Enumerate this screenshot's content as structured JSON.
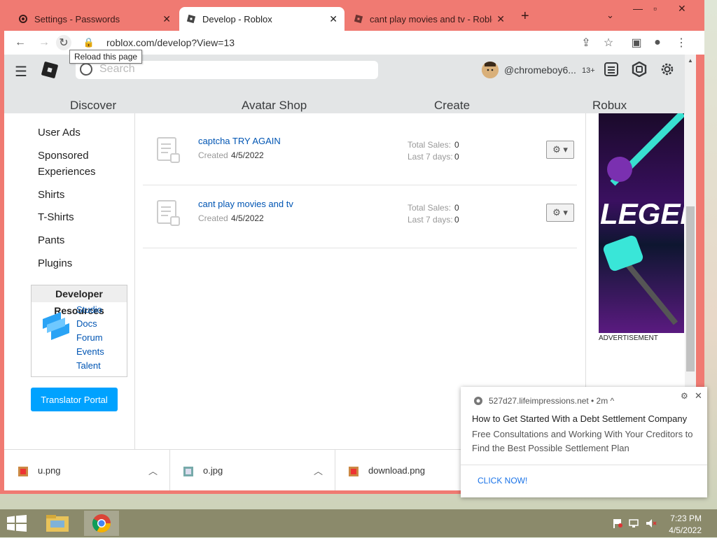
{
  "browser": {
    "tabs": [
      {
        "title": "Settings - Passwords",
        "active": false
      },
      {
        "title": "Develop - Roblox",
        "active": true
      },
      {
        "title": "cant play movies and tv - Roblox",
        "active": false
      }
    ],
    "new_tab": "+",
    "url": "roblox.com/develop?View=13",
    "tooltip": "Reload this page"
  },
  "roblox": {
    "search_placeholder": "Search",
    "nav": [
      "Discover",
      "Avatar Shop",
      "Create",
      "Robux"
    ],
    "username": "@chromeboy6...",
    "age_badge": "13+",
    "left_menu": [
      "User Ads",
      "Sponsored Experiences",
      "Shirts",
      "T-Shirts",
      "Pants",
      "Plugins"
    ],
    "dev_resources": {
      "title": "Developer Resources",
      "links": [
        "Studio",
        "Docs",
        "Forum",
        "Events",
        "Talent"
      ]
    },
    "translator_portal": "Translator Portal",
    "items": [
      {
        "name": "captcha TRY AGAIN",
        "created_label": "Created",
        "created": "4/5/2022",
        "total_sales_label": "Total Sales:",
        "total_sales": "0",
        "last7_label": "Last 7 days:",
        "last7": "0"
      },
      {
        "name": "cant play movies and tv",
        "created_label": "Created",
        "created": "4/5/2022",
        "total_sales_label": "Total Sales:",
        "total_sales": "0",
        "last7_label": "Last 7 days:",
        "last7": "0"
      }
    ],
    "gear_label": "⚙ ▾",
    "ad_label": "ADVERTISEMENT",
    "ad_text": "LEGEN"
  },
  "downloads": [
    {
      "name": "u.png"
    },
    {
      "name": "o.jpg"
    },
    {
      "name": "download.png"
    }
  ],
  "notification": {
    "source": "527d27.lifeimpressions.net",
    "time": "• 2m ^",
    "title": "How to Get Started With a Debt Settlement Company",
    "body": "Free Consultations and Working With Your Creditors to Find the Best Possible Settlement Plan",
    "cta": "CLICK NOW!"
  },
  "taskbar": {
    "time": "7:23 PM",
    "date": "4/5/2022"
  },
  "colors": {
    "browser_frame": "#f07a72",
    "link_blue": "#0055b3",
    "button_blue": "#00a2ff",
    "header_gray": "#e3e5e6"
  }
}
